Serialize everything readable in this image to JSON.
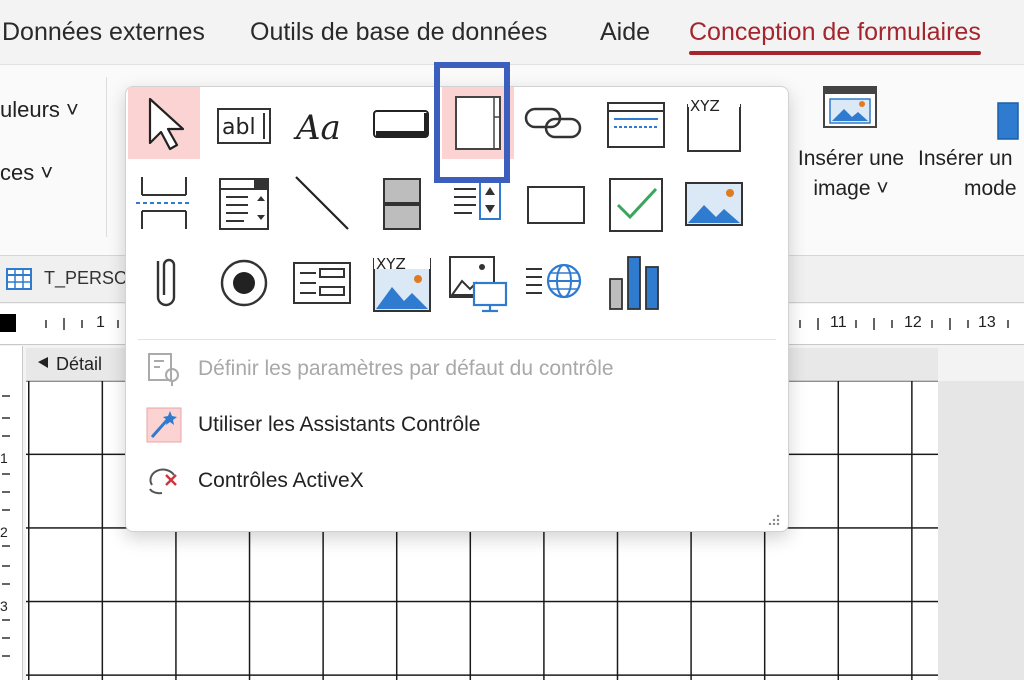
{
  "ribbon_tabs": [
    "Données externes",
    "Outils de base de données",
    "Aide",
    "Conception de formulaires"
  ],
  "ribbon": {
    "left_item1": "uleurs ˅",
    "left_item2": "ces ˅",
    "insert_image_line1": "Insérer une",
    "insert_image_line2": "image ˅",
    "insert_model_line1": "Insérer un",
    "insert_model_line2": "mode"
  },
  "object_tab": {
    "label": "T_PERSO"
  },
  "ruler": {
    "labels": [
      "1",
      "11",
      "12",
      "13"
    ]
  },
  "vertical_ruler": {
    "labels": [
      "1",
      "2",
      "3"
    ]
  },
  "section": {
    "label": "Détail"
  },
  "controls_menu": {
    "items": [
      {
        "label": "Définir les paramètres par défaut du contrôle",
        "disabled": true
      },
      {
        "label": "Utiliser les Assistants Contrôle",
        "disabled": false
      },
      {
        "label": "Contrôles ActiveX",
        "disabled": false
      }
    ],
    "icon_text_xyz": "XYZ"
  },
  "colors": {
    "accent": "#a4262c",
    "highlight_box": "#3c5ebd",
    "selected_cell": "#fbd3d3",
    "icon_blue": "#2e7bcf",
    "icon_green": "#3aa55d"
  }
}
